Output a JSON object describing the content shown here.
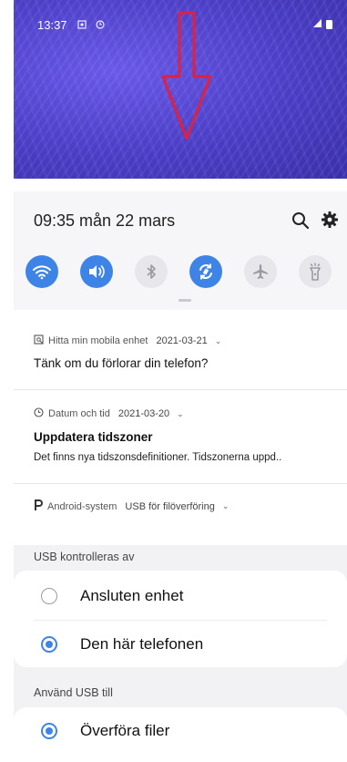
{
  "screenshot_top": {
    "status_time": "13:37"
  },
  "quick_settings": {
    "time_date": "09:35  mån 22 mars",
    "toggles": [
      {
        "name": "wifi",
        "state": "on"
      },
      {
        "name": "sound",
        "state": "on"
      },
      {
        "name": "bluetooth",
        "state": "off"
      },
      {
        "name": "auto-rotate",
        "state": "on"
      },
      {
        "name": "airplane-mode",
        "state": "off"
      },
      {
        "name": "flashlight",
        "state": "off"
      }
    ]
  },
  "notifications": [
    {
      "app": "Hitta min mobila enhet",
      "date": "2021-03-21",
      "title": "Tänk om du förlorar din telefon?"
    },
    {
      "app": "Datum och tid",
      "date": "2021-03-20",
      "title": "Uppdatera tidszoner",
      "body": "Det finns nya tidszonsdefinitioner. Tidszonerna uppd.."
    },
    {
      "app": "Android-system",
      "date": "USB för filöverföring"
    }
  ],
  "usb_settings": {
    "controlled_by_label": "USB kontrolleras av",
    "controlled_by_options": [
      {
        "label": "Ansluten enhet",
        "selected": false
      },
      {
        "label": "Den här telefonen",
        "selected": true
      }
    ],
    "use_for_label": "Använd USB till",
    "use_for_options": [
      {
        "label": "Överföra filer",
        "selected": true
      }
    ]
  },
  "colors": {
    "accent": "#3e84e6",
    "wallpaper": "#4b3dc4",
    "arrow": "#e0203c"
  }
}
